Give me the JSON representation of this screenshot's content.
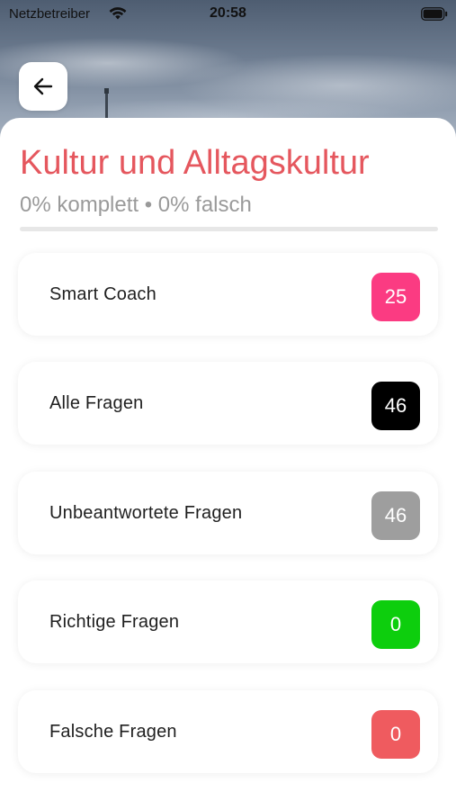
{
  "status_bar": {
    "carrier": "Netzbetreiber",
    "time": "20:58",
    "wifi_icon": "wifi-icon",
    "battery_icon": "battery-icon"
  },
  "header": {
    "back_icon": "arrow-left-icon",
    "title": "Kultur und Alltagskultur",
    "subtitle": "0% komplett • 0% falsch",
    "progress_complete": 0
  },
  "colors": {
    "title": "#e5575e",
    "smart_coach": "#fb3b82",
    "all": "#000000",
    "unanswered": "#9e9e9e",
    "correct": "#0dce0d",
    "wrong": "#ef5b5f"
  },
  "list": {
    "items": [
      {
        "label": "Smart Coach",
        "count": "25",
        "color": "#fb3b82"
      },
      {
        "label": "Alle Fragen",
        "count": "46",
        "color": "#000000"
      },
      {
        "label": "Unbeantwortete Fragen",
        "count": "46",
        "color": "#9e9e9e"
      },
      {
        "label": "Richtige Fragen",
        "count": "0",
        "color": "#0dce0d"
      },
      {
        "label": "Falsche Fragen",
        "count": "0",
        "color": "#ef5b5f"
      }
    ]
  }
}
